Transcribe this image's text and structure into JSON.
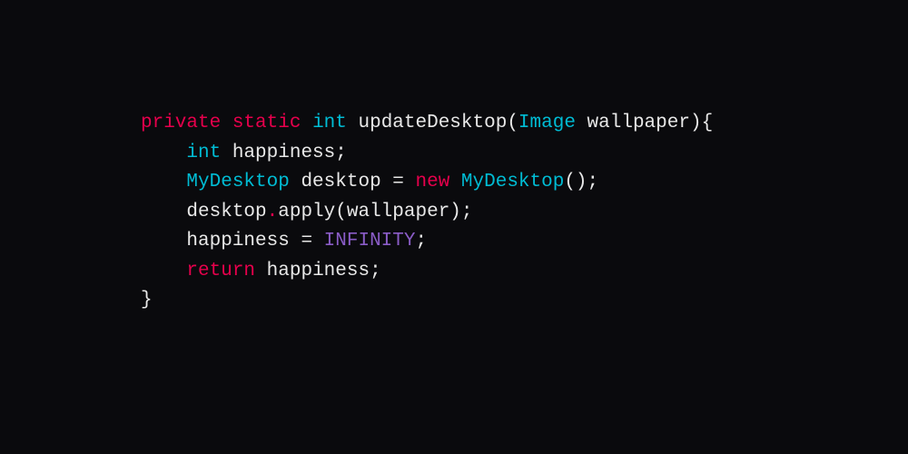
{
  "code": {
    "line1": {
      "kw_private": "private",
      "kw_static": "static",
      "type_int": "int",
      "fn_name": "updateDesktop",
      "open_paren": "(",
      "param_type": "Image",
      "param_name": "wallpaper",
      "close_paren_brace": "){"
    },
    "line2": {
      "indent": "    ",
      "type_int": "int",
      "var": "happiness",
      "semi": ";"
    },
    "line3": {
      "indent": "    ",
      "type_class": "MyDesktop",
      "var": "desktop",
      "eq": " = ",
      "kw_new": "new",
      "ctor": "MyDesktop",
      "parens_semi": "();"
    },
    "line4": {
      "indent": "    ",
      "obj": "desktop",
      "dot": ".",
      "method": "apply",
      "open_paren": "(",
      "arg": "wallpaper",
      "close_paren_semi": ");"
    },
    "line5": {
      "indent": "    ",
      "var": "happiness",
      "eq": " = ",
      "const": "INFINITY",
      "semi": ";"
    },
    "line6": {
      "indent": "    ",
      "kw_return": "return",
      "var": "happiness",
      "semi": ";"
    },
    "line7": {
      "close_brace": "}"
    }
  }
}
